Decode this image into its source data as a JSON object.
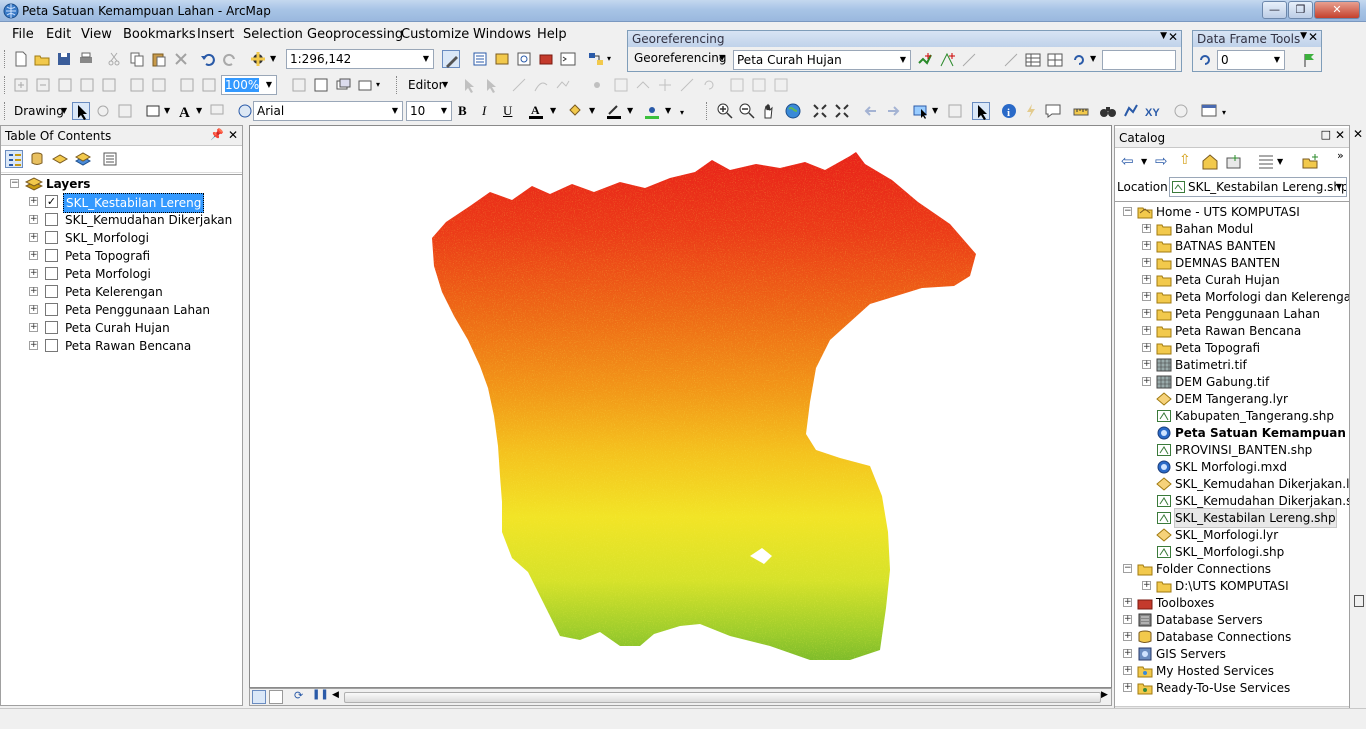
{
  "window": {
    "title": "Peta Satuan Kemampuan Lahan - ArcMap"
  },
  "menu": [
    "File",
    "Edit",
    "View",
    "Bookmarks",
    "Insert",
    "Selection",
    "Geoprocessing",
    "Customize",
    "Windows",
    "Help"
  ],
  "standard_toolbar": {
    "scale": "1:296,142"
  },
  "editor_toolbar": {
    "editor_label": "Editor",
    "zoom_value": "100%"
  },
  "drawing_toolbar": {
    "drawing_label": "Drawing",
    "font_name": "Arial",
    "font_size": "10",
    "bold": "B",
    "italic": "I",
    "underline": "U"
  },
  "georef": {
    "title": "Georeferencing",
    "menu_label": "Georeferencing",
    "layer": "Peta Curah Hujan"
  },
  "dataframe_tools": {
    "title": "Data Frame Tools",
    "value": "0"
  },
  "toc": {
    "title": "Table Of Contents",
    "root": "Layers",
    "layers": [
      {
        "name": "SKL_Kestabilan Lereng",
        "checked": true
      },
      {
        "name": "SKL_Kemudahan Dikerjakan",
        "checked": false
      },
      {
        "name": "SKL_Morfologi",
        "checked": false
      },
      {
        "name": "Peta Topografi",
        "checked": false
      },
      {
        "name": "Peta Morfologi",
        "checked": false
      },
      {
        "name": "Peta Kelerengan",
        "checked": false
      },
      {
        "name": "Peta Penggunaan Lahan",
        "checked": false
      },
      {
        "name": "Peta Curah Hujan",
        "checked": false
      },
      {
        "name": "Peta Rawan Bencana",
        "checked": false
      }
    ]
  },
  "catalog": {
    "title": "Catalog",
    "location_label": "Location:",
    "location_value": "SKL_Kestabilan Lereng.shp",
    "home": "Home - UTS KOMPUTASI",
    "home_items": [
      {
        "name": "Bahan Modul",
        "type": "folder"
      },
      {
        "name": "BATNAS BANTEN",
        "type": "folder"
      },
      {
        "name": "DEMNAS BANTEN",
        "type": "folder"
      },
      {
        "name": "Peta Curah Hujan",
        "type": "folder"
      },
      {
        "name": "Peta Morfologi dan Kelerengan",
        "type": "folder"
      },
      {
        "name": "Peta Penggunaan Lahan",
        "type": "folder"
      },
      {
        "name": "Peta Rawan Bencana",
        "type": "folder"
      },
      {
        "name": "Peta Topografi",
        "type": "folder"
      },
      {
        "name": "Batimetri.tif",
        "type": "raster"
      },
      {
        "name": "DEM Gabung.tif",
        "type": "raster"
      },
      {
        "name": "DEM Tangerang.lyr",
        "type": "lyr"
      },
      {
        "name": "Kabupaten_Tangerang.shp",
        "type": "shp"
      },
      {
        "name": "Peta Satuan Kemampuan Laha",
        "type": "mxd",
        "bold": true
      },
      {
        "name": "PROVINSI_BANTEN.shp",
        "type": "shp"
      },
      {
        "name": "SKL Morfologi.mxd",
        "type": "mxd"
      },
      {
        "name": "SKL_Kemudahan Dikerjakan.lyr",
        "type": "lyr"
      },
      {
        "name": "SKL_Kemudahan Dikerjakan.shp",
        "type": "shp"
      },
      {
        "name": "SKL_Kestabilan Lereng.shp",
        "type": "shp",
        "selected": true
      },
      {
        "name": "SKL_Morfologi.lyr",
        "type": "lyr"
      },
      {
        "name": "SKL_Morfologi.shp",
        "type": "shp"
      }
    ],
    "folder_connections": "Folder Connections",
    "folder_items": [
      "D:\\UTS KOMPUTASI"
    ],
    "roots": [
      "Toolboxes",
      "Database Servers",
      "Database Connections",
      "GIS Servers",
      "My Hosted Services",
      "Ready-To-Use Services"
    ]
  },
  "colors": {
    "accent": "#3399ff",
    "map_red": "#e8291c",
    "map_orange": "#f08a1a",
    "map_yellow": "#f4ee2a",
    "map_green": "#6cb52a"
  }
}
